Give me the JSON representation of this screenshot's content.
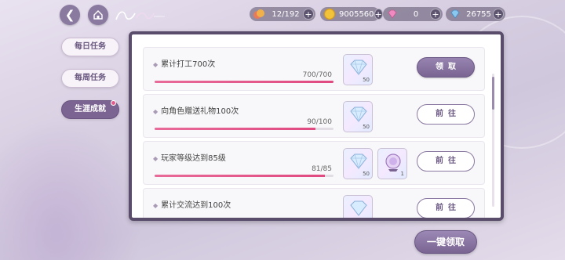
{
  "header": {
    "resources": [
      {
        "icon": "stamina-icon",
        "value": "12/192"
      },
      {
        "icon": "gold-coin-icon",
        "value": "9005560"
      },
      {
        "icon": "pink-diamond-icon",
        "value": "0"
      },
      {
        "icon": "blue-diamond-icon",
        "value": "26755"
      }
    ],
    "plus_label": "+"
  },
  "tabs": [
    {
      "label": "每日任务",
      "active": false
    },
    {
      "label": "每周任务",
      "active": false
    },
    {
      "label": "生涯成就",
      "active": true
    }
  ],
  "tasks": [
    {
      "title": "累计打工700次",
      "progress": "700/700",
      "fraction": 1.0,
      "rewards": [
        {
          "icon": "diamond-icon",
          "qty": "50"
        }
      ],
      "action": "领取",
      "action_type": "claim"
    },
    {
      "title": "向角色赠送礼物100次",
      "progress": "90/100",
      "fraction": 0.9,
      "rewards": [
        {
          "icon": "diamond-icon",
          "qty": "50"
        }
      ],
      "action": "前往",
      "action_type": "go"
    },
    {
      "title": "玩家等级达到85级",
      "progress": "81/85",
      "fraction": 0.953,
      "rewards": [
        {
          "icon": "diamond-icon",
          "qty": "50"
        },
        {
          "icon": "crystal-ball-icon",
          "qty": "1"
        }
      ],
      "action": "前往",
      "action_type": "go"
    },
    {
      "title": "累计交流达到100次",
      "progress": "",
      "fraction": 0.0,
      "rewards": [
        {
          "icon": "diamond-icon",
          "qty": ""
        }
      ],
      "action": "前往",
      "action_type": "go"
    }
  ],
  "footer": {
    "claim_all_label": "一键领取"
  },
  "colors": {
    "accent": "#7b6491",
    "progress": "#e04a80",
    "panel_border": "#5a4d6b"
  }
}
